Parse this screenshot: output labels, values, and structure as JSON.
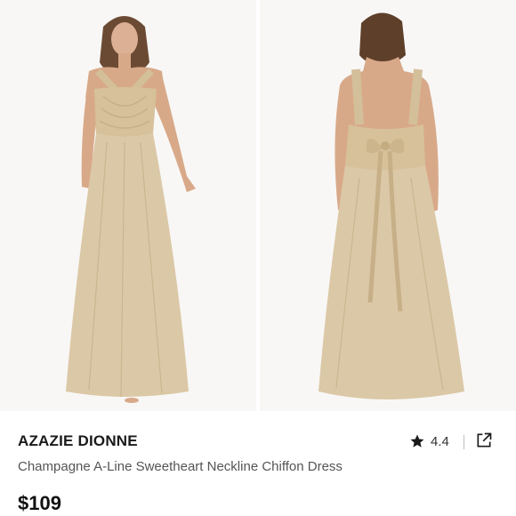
{
  "product": {
    "brand": "AZAZIE DIONNE",
    "title": "Champagne A-Line Sweetheart Neckline Chiffon Dress",
    "price": "$109",
    "rating": "4.4"
  },
  "images": [
    {
      "alt": "front view",
      "icon": "dress-front-image"
    },
    {
      "alt": "back view",
      "icon": "dress-back-image"
    }
  ],
  "icons": {
    "rating": "star-icon",
    "share": "external-link-icon"
  },
  "colors": {
    "dress": "#d9c6a3",
    "skin": "#d8a989",
    "hair": "#6b4a33",
    "background": "#f8f7f5",
    "text": "#1a1a1a"
  }
}
